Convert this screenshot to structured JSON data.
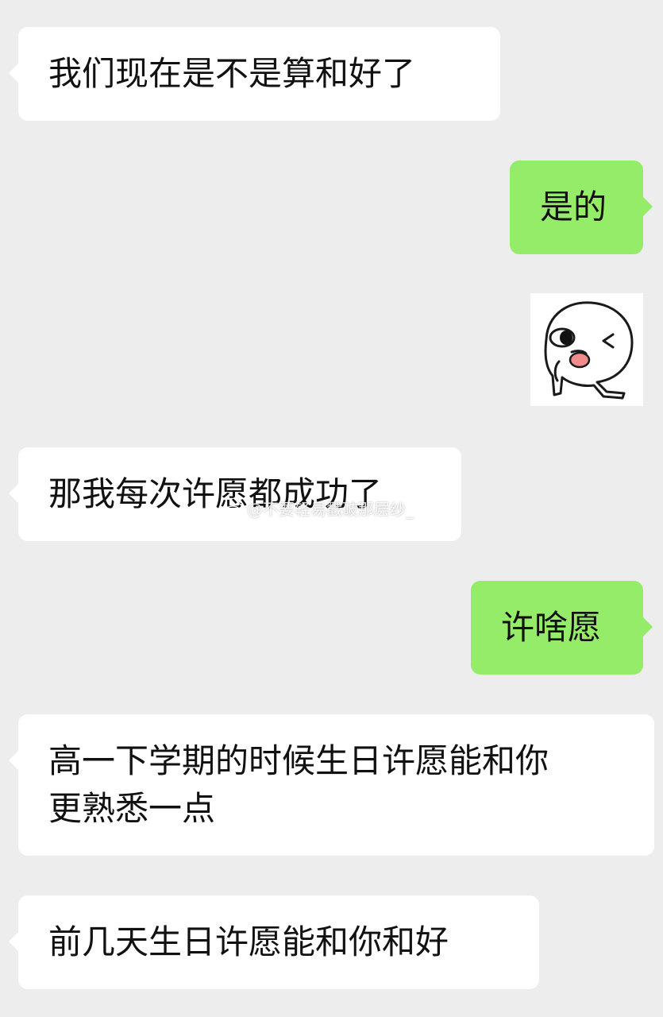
{
  "colors": {
    "background": "#ededed",
    "incoming_bubble": "#ffffff",
    "outgoing_bubble": "#95ec69",
    "text": "#111111"
  },
  "messages": [
    {
      "side": "left",
      "text": "我们现在是不是算和好了"
    },
    {
      "side": "right",
      "text": "是的"
    },
    {
      "side": "right",
      "type": "sticker",
      "sticker": "winking-face-tongue-out-sticker"
    },
    {
      "side": "left",
      "text": "那我每次许愿都成功了"
    },
    {
      "side": "right",
      "text": "许啥愿"
    },
    {
      "side": "left",
      "lines": [
        "高一下学期的时候生日许愿能和你",
        "更熟悉一点"
      ]
    },
    {
      "side": "left",
      "text": "前几天生日许愿能和你和好"
    }
  ],
  "watermark": {
    "text": "@不要轻易戳破那层纱_",
    "icon": "weibo-icon"
  }
}
